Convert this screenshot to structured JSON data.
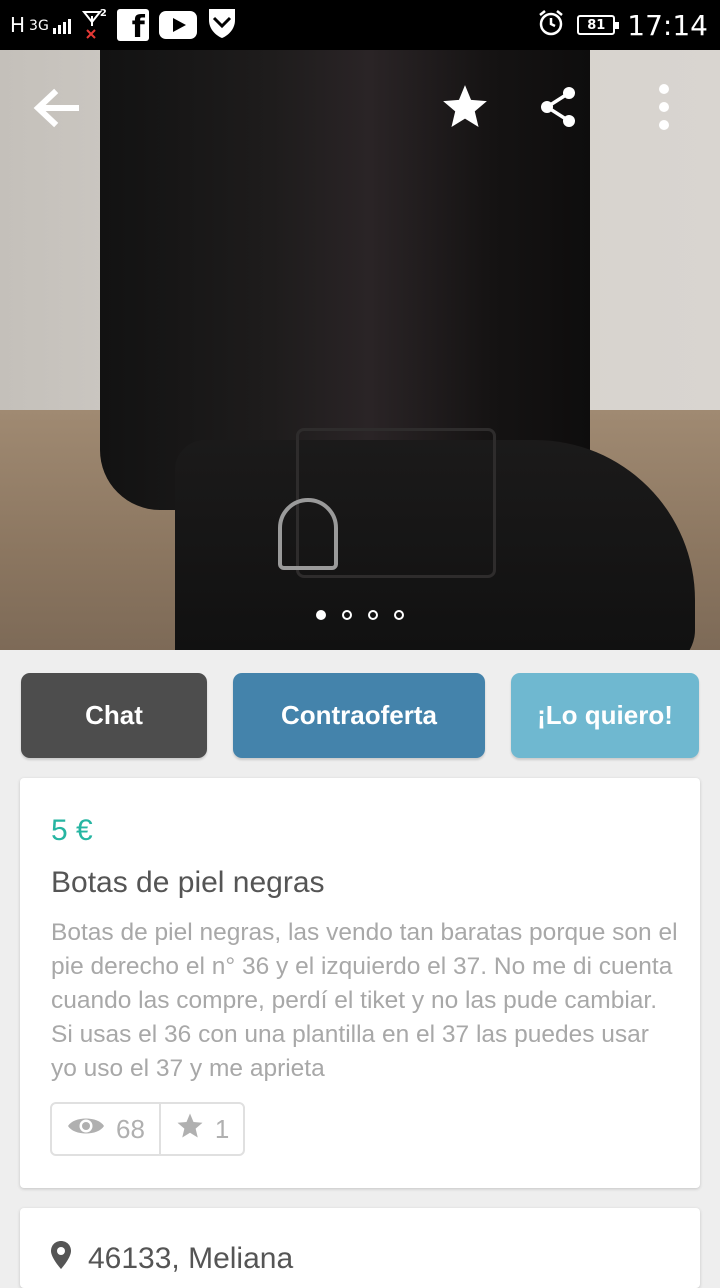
{
  "status_bar": {
    "network_type": "H",
    "network_gen": "3G",
    "sim_label": "2",
    "battery": "81",
    "time": "17:14",
    "icons": [
      "facebook-icon",
      "youtube-icon",
      "shield-icon",
      "alarm-icon"
    ]
  },
  "gallery": {
    "photo_count": 4,
    "active_index": 0,
    "photo_subject": "black leather riding boot",
    "icons": {
      "back": "arrow-back-icon",
      "favorite": "star-icon",
      "share": "share-icon",
      "more": "more-vert-icon"
    }
  },
  "actions": {
    "chat_label": "Chat",
    "counter_offer_label": "Contraoferta",
    "want_label": "¡Lo quiero!"
  },
  "item": {
    "price": "5 €",
    "title": "Botas de piel negras",
    "description": "Botas de piel negras, las vendo tan baratas porque son el pie derecho el n° 36 y el izquierdo el 37. No me di cuenta cuando las compre, perdí el tiket y no las pude cambiar. Si usas el 36 con una plantilla en el 37 las puedes usar yo uso el 37 y me aprieta",
    "views": "68",
    "favorites": "1"
  },
  "location": {
    "text": "46133, Meliana"
  },
  "colors": {
    "price": "#26b5a2",
    "chat_button": "#4d4d4d",
    "counter_button": "#4483ab",
    "want_button": "#6fb8d0"
  }
}
